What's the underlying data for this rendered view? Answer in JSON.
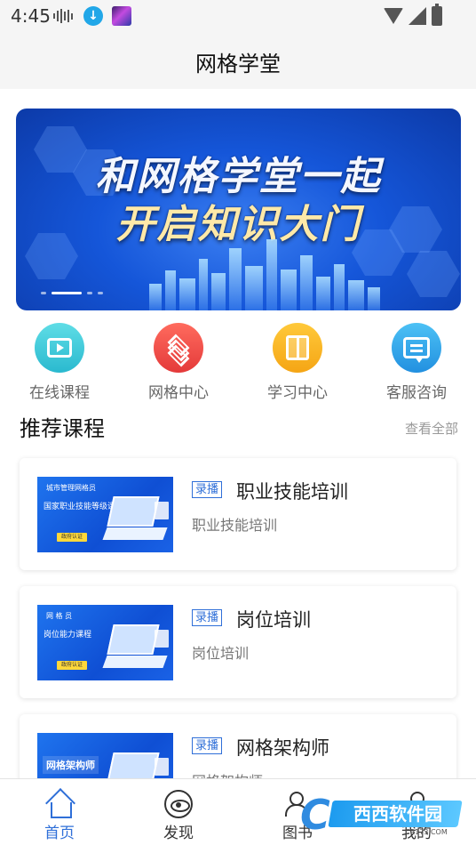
{
  "status_bar": {
    "time": "4:45"
  },
  "header": {
    "title": "网格学堂"
  },
  "banner": {
    "line1": "和网格学堂一起",
    "line2": "开启知识大门"
  },
  "quick_links": [
    {
      "label": "在线课程",
      "icon": "video-play-icon",
      "color": "#3ec9d6"
    },
    {
      "label": "网格中心",
      "icon": "layers-icon",
      "color": "#ef4a4a"
    },
    {
      "label": "学习中心",
      "icon": "book-icon",
      "color": "#f7b21c"
    },
    {
      "label": "客服咨询",
      "icon": "chat-icon",
      "color": "#2ea6ea"
    }
  ],
  "recommended": {
    "title": "推荐课程",
    "view_all": "查看全部",
    "courses": [
      {
        "tag": "录播",
        "title": "职业技能培训",
        "subtitle": "职业技能培训",
        "thumb_line1": "城市管理网格员",
        "thumb_line2": "国家职业技能等级课程",
        "thumb_badge": "政府认证"
      },
      {
        "tag": "录播",
        "title": "岗位培训",
        "subtitle": "岗位培训",
        "thumb_line1": "网 格 员",
        "thumb_line2": "岗位能力课程",
        "thumb_badge": "政府认证"
      },
      {
        "tag": "录播",
        "title": "网格架构师",
        "subtitle": "网格架构师",
        "thumb_line1": "",
        "thumb_line2": "网格架构师",
        "thumb_badge": ""
      }
    ]
  },
  "bottom_nav": [
    {
      "label": "首页",
      "icon": "home-icon",
      "active": true
    },
    {
      "label": "发现",
      "icon": "eye-icon",
      "active": false
    },
    {
      "label": "图书",
      "icon": "people-icon",
      "active": false
    },
    {
      "label": "我的",
      "icon": "person-icon",
      "active": false
    }
  ],
  "watermark": {
    "text": "西西软件园",
    "sub": "CR173.COM"
  },
  "colors": {
    "accent": "#2f6fd8",
    "background": "#f5f5f5"
  }
}
